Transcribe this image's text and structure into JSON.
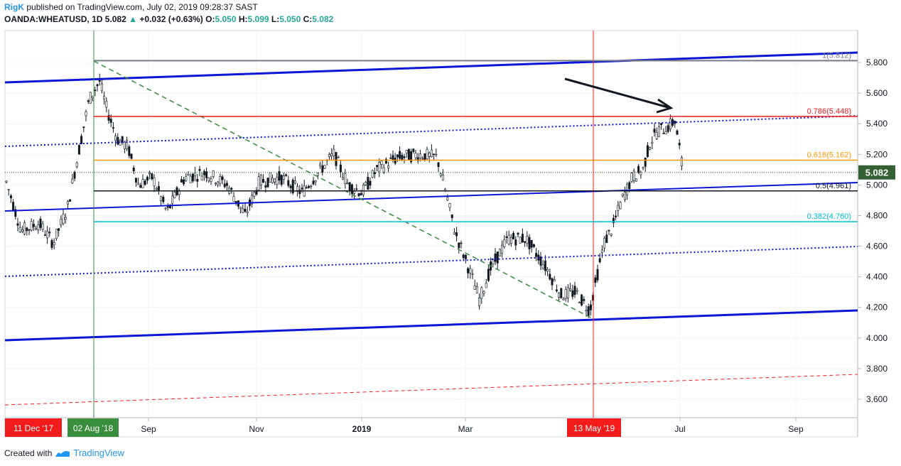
{
  "header": {
    "author": "RigK",
    "published": "published on TradingView.com, July 02, 2019 09:28:37 SAST",
    "symbol": "OANDA:WHEATUSD, 1D",
    "last": "5.082",
    "up_arrow": "▲",
    "change": "+0.032 (+0.63%)",
    "o_label": "O:",
    "o_value": "5.050",
    "h_label": "H:",
    "h_value": "5.099",
    "l_label": "L:",
    "l_value": "5.050",
    "c_label": "C:",
    "c_value": "5.082"
  },
  "footer": {
    "created_with": "Created with",
    "brand": "TradingView"
  },
  "chart_data": {
    "type": "candlestick",
    "title": "",
    "ylim": [
      3.53,
      5.95
    ],
    "y_ticks": [
      "5.800",
      "5.600",
      "5.400",
      "5.200",
      "5.000",
      "4.800",
      "4.600",
      "4.400",
      "4.200",
      "4.000",
      "3.800",
      "3.600"
    ],
    "x_ticks": [
      "Sep",
      "Nov",
      "2019",
      "Mar",
      "Jul",
      "Sep"
    ],
    "x_date_labels": [
      {
        "label": "11 Dec '17",
        "color": "#f21c1c"
      },
      {
        "label": "02 Aug '18",
        "color": "#388e3c"
      },
      {
        "label": "13 May '19",
        "color": "#f21c1c"
      }
    ],
    "last_price": {
      "label": "5.082",
      "value": 5.082,
      "color": "#346134"
    },
    "fib_levels": [
      {
        "label": "1(5.812)",
        "value": 5.812,
        "color": "#787b86"
      },
      {
        "label": "0.786(5.448)",
        "value": 5.448,
        "color": "#f21c1c"
      },
      {
        "label": "0.618(5.162)",
        "value": 5.162,
        "color": "#ff9800"
      },
      {
        "label": "0.5(4.961)",
        "value": 4.961,
        "color": "#131722"
      },
      {
        "label": "0.382(4.760)",
        "value": 4.76,
        "color": "#00bcd4"
      }
    ],
    "grid": true,
    "colors": {
      "channel": "#0c17d6",
      "up": "#ffffff",
      "down": "#131722",
      "trend": "#388e3c",
      "vline_green": "#388e3c",
      "vline_red": "#f21c1c"
    }
  }
}
